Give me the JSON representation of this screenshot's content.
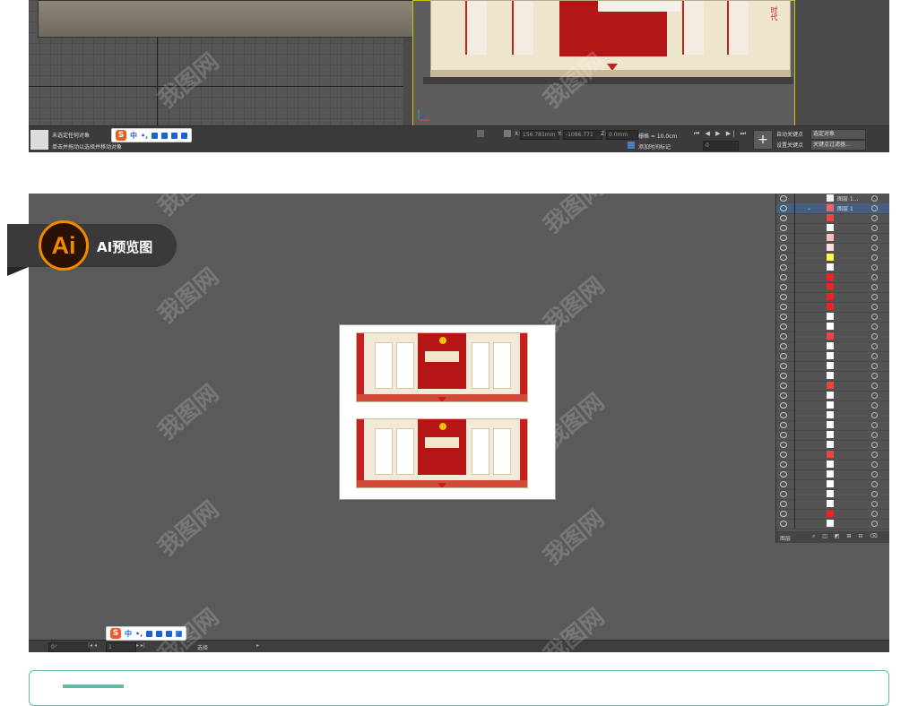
{
  "max_panel": {
    "status_line1": "未选定任何对象",
    "status_line2": "单击并拖动以选择并移动对象",
    "coord_x_label": "X:",
    "coord_x_value": "156.781mm",
    "coord_y_label": "Y:",
    "coord_y_value": "-1086.771",
    "coord_z_label": "Z:",
    "coord_z_value": "0.0mm",
    "grid_label": "栅格 = 10.0cm",
    "time_tag_label": "添加时间标记",
    "auto_key_label": "自动关键点",
    "set_key_label": "设置关键点",
    "selection_dropdown": "选定对象",
    "key_filter_label": "关键点过滤器...",
    "frame_value": "0",
    "wall_vertical_text": "时代"
  },
  "ime": {
    "logo": "S",
    "mode": "中",
    "punct": "•,"
  },
  "ai_panel": {
    "badge_logo": "Ai",
    "badge_label": "AI预览图",
    "zoom_value": "0°",
    "page_value": "1",
    "status_text": "选择",
    "layers_footer_label": "图层",
    "layers": [
      {
        "name": "图层 1..."
      },
      {
        "name": "图层 1"
      }
    ]
  },
  "watermark": "我图网",
  "colors": {
    "brand_red": "#c81e1e",
    "ai_orange": "#f28a00",
    "teal": "#66b8a6",
    "viewport_highlight": "#d4c200"
  }
}
